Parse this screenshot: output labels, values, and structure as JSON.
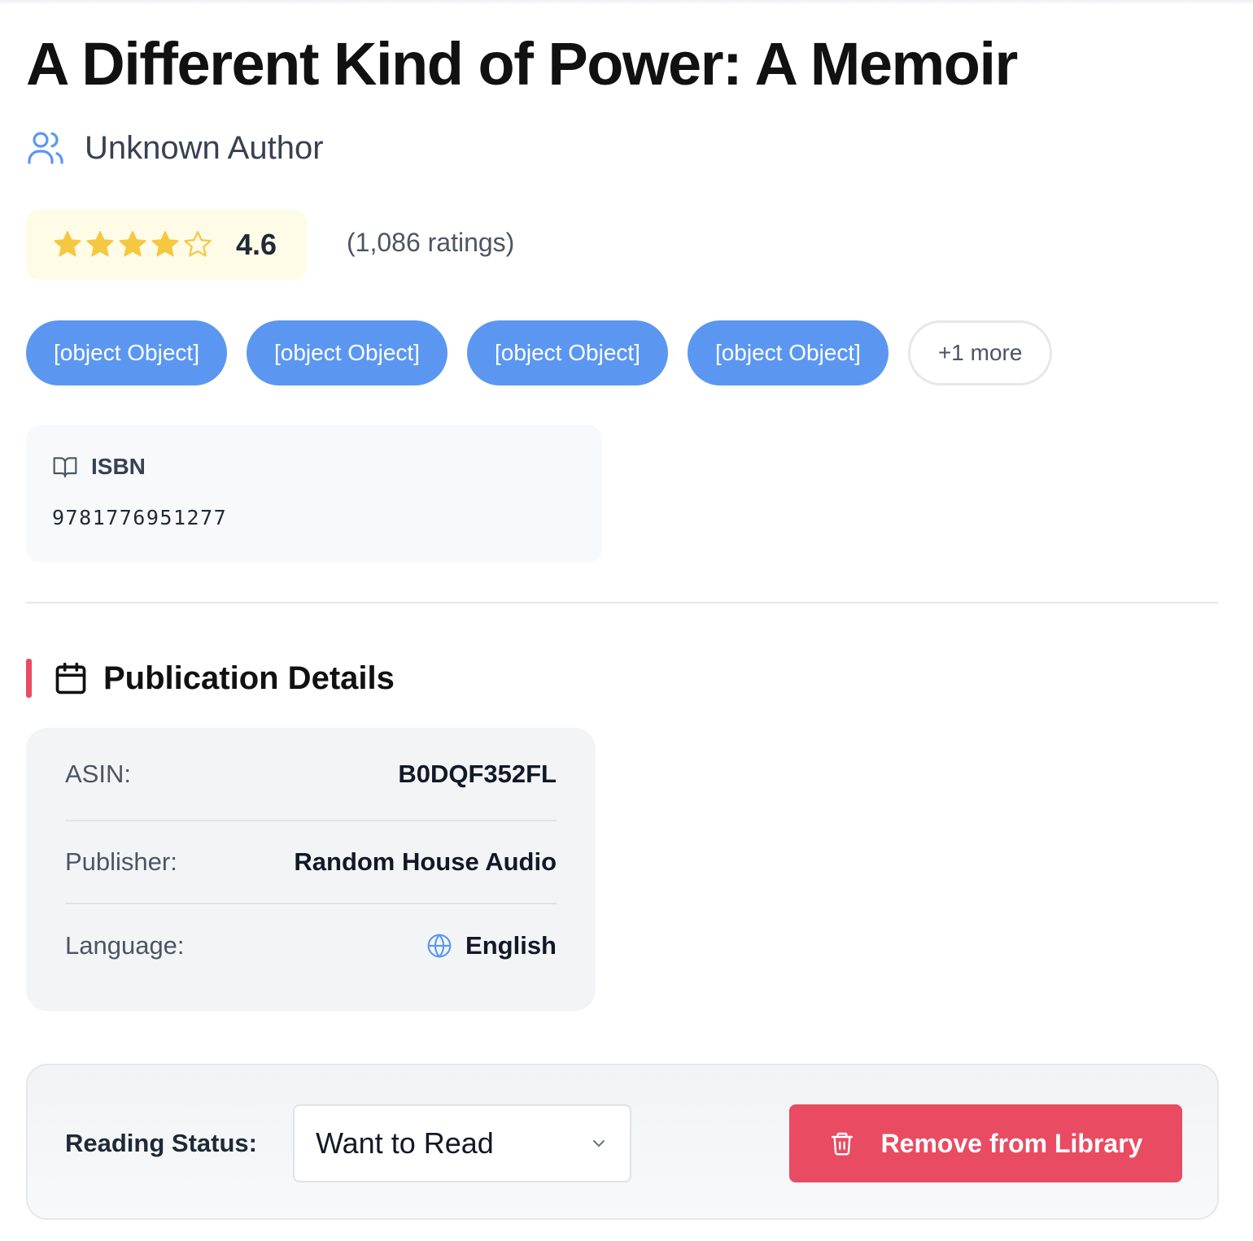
{
  "book": {
    "title": "A Different Kind of Power: A Memoir",
    "author": "Unknown Author",
    "author_icon": "users-icon"
  },
  "rating": {
    "value": "4.6",
    "count_text": "(1,086 ratings)",
    "stars_filled": 4,
    "stars_total": 5,
    "star_color": "#f5c842"
  },
  "tags": {
    "items": [
      "[object Object]",
      "[object Object]",
      "[object Object]",
      "[object Object]"
    ],
    "more_label": "+1 more",
    "color": "#5b97f0"
  },
  "isbn": {
    "label": "ISBN",
    "value": "9781776951277",
    "icon": "open-book-icon"
  },
  "publication": {
    "title": "Publication Details",
    "icon": "calendar-icon",
    "accent_color": "#e94b62",
    "rows": [
      {
        "label": "ASIN:",
        "value": "B0DQF352FL"
      },
      {
        "label": "Publisher:",
        "value": "Random House Audio"
      },
      {
        "label": "Language:",
        "value": "English",
        "icon": "globe-icon"
      }
    ]
  },
  "status": {
    "label": "Reading Status:",
    "selected": "Want to Read",
    "remove_label": "Remove from Library",
    "remove_color": "#e94b62"
  }
}
